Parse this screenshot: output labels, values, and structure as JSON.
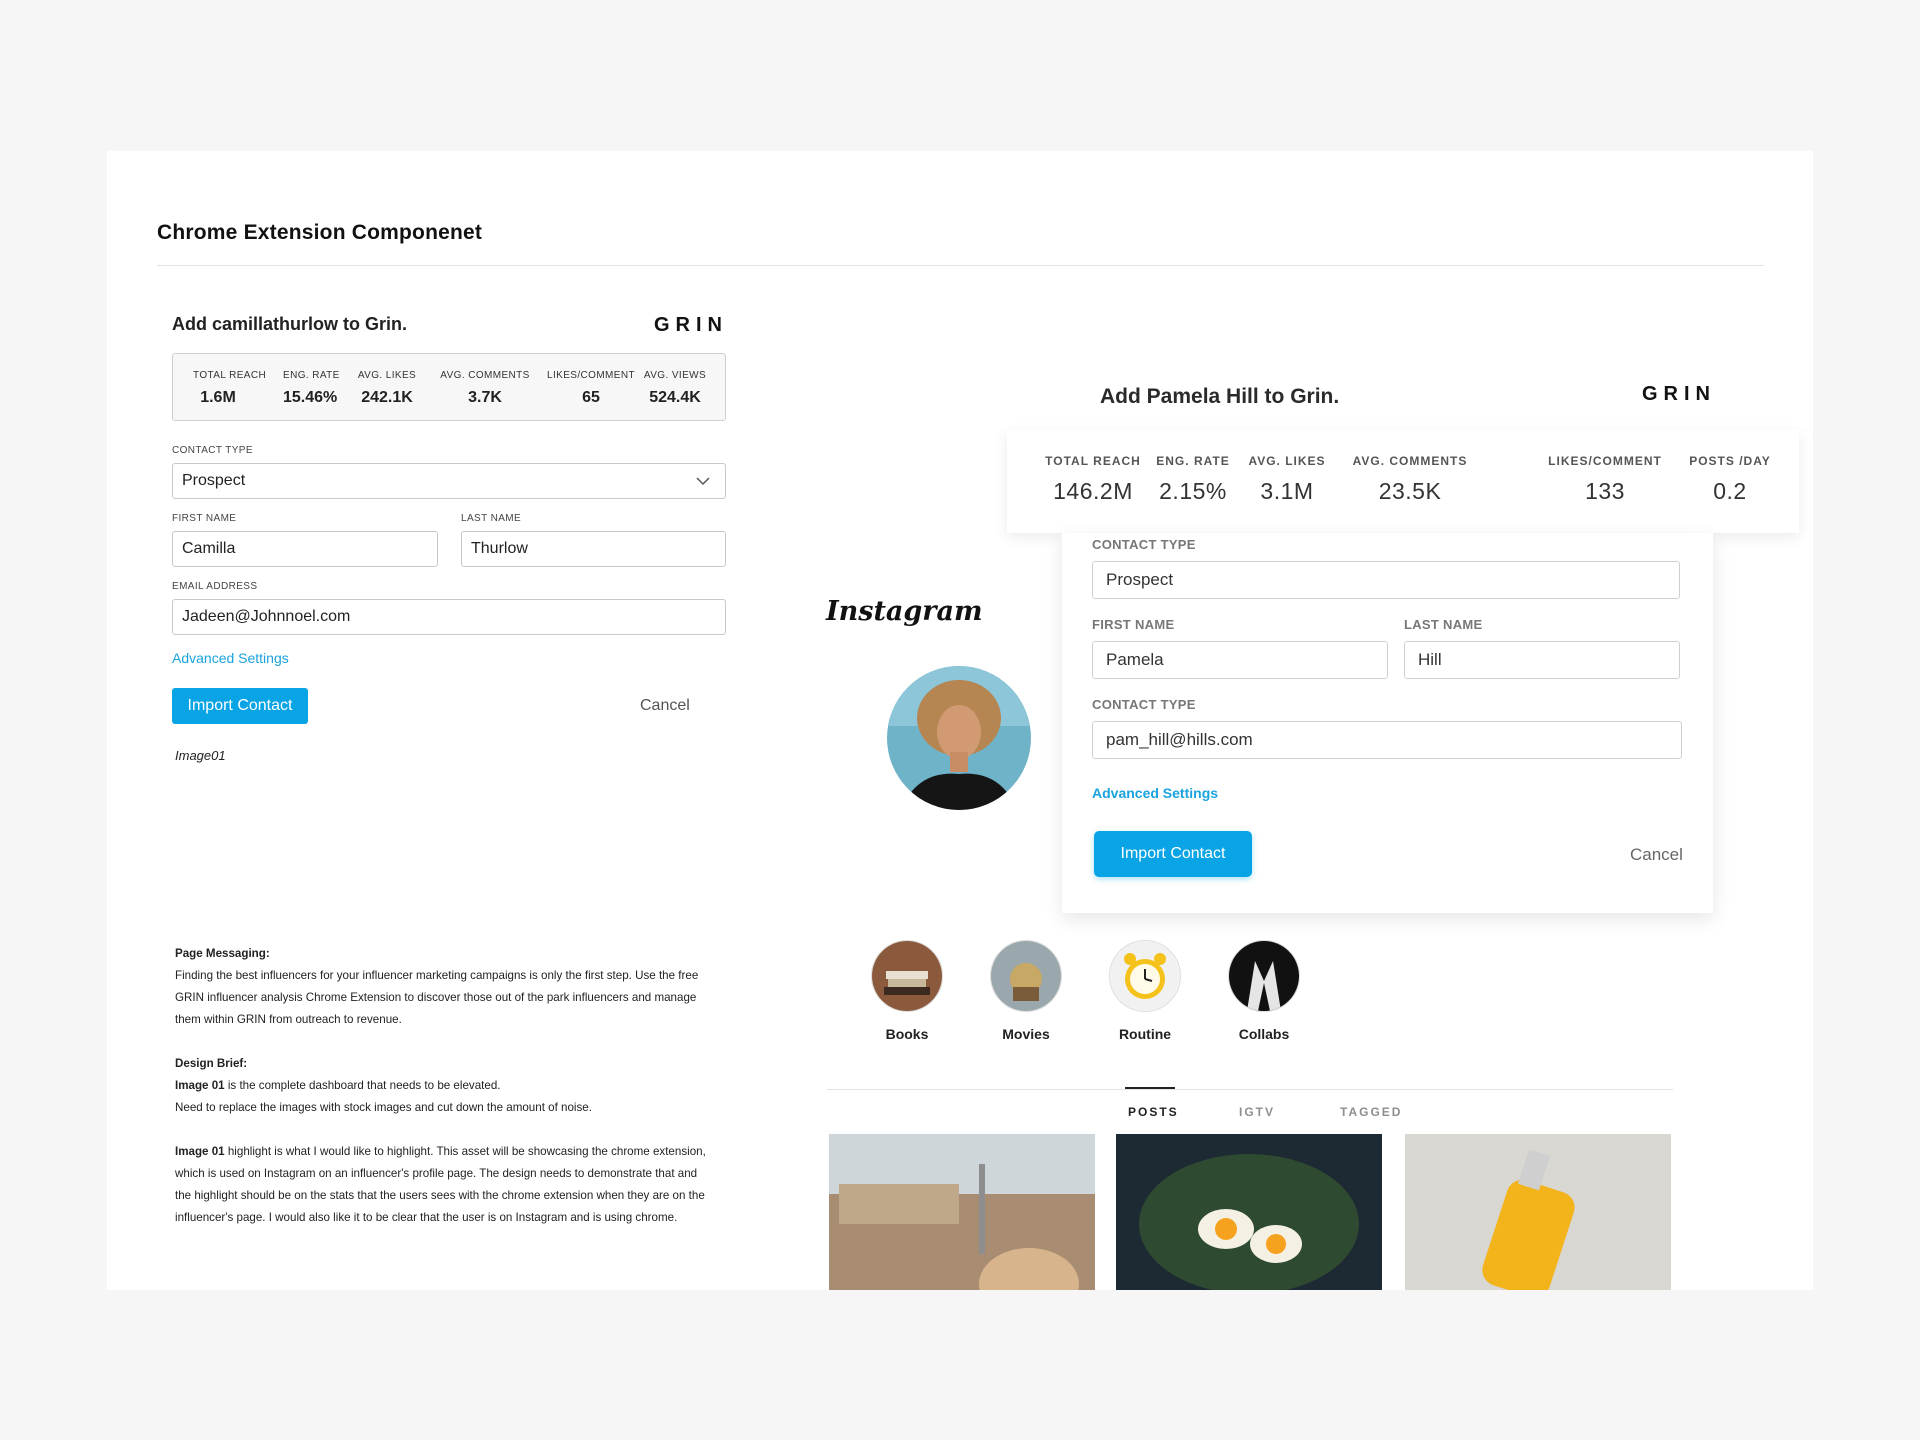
{
  "section_title": "Chrome Extension Componenet",
  "brand_logo": "GRIN",
  "panel1": {
    "title": "Add camillathurlow to Grin.",
    "stats": [
      {
        "label": "TOTAL REACH",
        "value": "1.6M"
      },
      {
        "label": "ENG. RATE",
        "value": "15.46%"
      },
      {
        "label": "AVG. LIKES",
        "value": "242.1K"
      },
      {
        "label": "AVG. COMMENTS",
        "value": "3.7K"
      },
      {
        "label": "LIKES/COMMENT",
        "value": "65"
      },
      {
        "label": "AVG. VIEWS",
        "value": "524.4K"
      }
    ],
    "contact_type_label": "CONTACT TYPE",
    "contact_type_value": "Prospect",
    "first_name_label": "FIRST NAME",
    "first_name_value": "Camilla",
    "last_name_label": "LAST NAME",
    "last_name_value": "Thurlow",
    "email_label": "EMAIL ADDRESS",
    "email_value": "Jadeen@Johnnoel.com",
    "advanced_settings": "Advanced Settings",
    "import_button": "Import Contact",
    "cancel_button": "Cancel",
    "caption": "Image01"
  },
  "notes": {
    "page_messaging_heading": "Page Messaging:",
    "page_messaging_lines": [
      "Finding the best influencers for your influencer marketing campaigns is only the first step. Use the free",
      "GRIN influencer analysis Chrome Extension to discover those out of the park influencers and manage",
      "them within GRIN from outreach to revenue."
    ],
    "design_brief_heading": "Design Brief:",
    "brief_line1_bold": "Image 01",
    "brief_line1_rest": " is the complete dashboard that needs to be elevated.",
    "brief_line2": "Need to replace the images with stock images and cut down the amount of noise.",
    "brief_p2_bold": "Image 01",
    "brief_p2_lines": [
      " highlight is what I would like to highlight. This asset will be showcasing the chrome extension,",
      "which is used on Instagram on an influencer's profile page. The design needs to demonstrate that and",
      "the highlight should be on the stats that the users sees with the chrome extension when they are on the",
      "influencer's page. I would also like it to be clear that the user is on Instagram and is using chrome."
    ]
  },
  "instagram": {
    "logo": "Instagram",
    "highlights": [
      {
        "label": "Books",
        "icon": "books-icon"
      },
      {
        "label": "Movies",
        "icon": "movies-icon"
      },
      {
        "label": "Routine",
        "icon": "alarm-clock-icon"
      },
      {
        "label": "Collabs",
        "icon": "collabs-icon"
      }
    ],
    "tabs": [
      "POSTS",
      "IGTV",
      "TAGGED"
    ],
    "active_tab": "POSTS"
  },
  "panel2": {
    "title": "Add Pamela Hill to Grin.",
    "stats": [
      {
        "label": "TOTAL REACH",
        "value": "146.2M"
      },
      {
        "label": "ENG. RATE",
        "value": "2.15%"
      },
      {
        "label": "AVG. LIKES",
        "value": "3.1M"
      },
      {
        "label": "AVG. COMMENTS",
        "value": "23.5K"
      },
      {
        "label": "LIKES/COMMENT",
        "value": "133"
      },
      {
        "label": "POSTS /DAY",
        "value": "0.2"
      }
    ],
    "contact_type_label": "CONTACT TYPE",
    "contact_type_value": "Prospect",
    "first_name_label": "FIRST NAME",
    "first_name_value": "Pamela",
    "last_name_label": "LAST NAME",
    "last_name_value": "Hill",
    "email_label": "CONTACT TYPE",
    "email_value": "pam_hill@hills.com",
    "advanced_settings": "Advanced Settings",
    "import_button": "Import Contact",
    "cancel_button": "Cancel"
  },
  "colors": {
    "accent": "#09a4e5",
    "link": "#1aa3df",
    "page_background": "#f6f6f6"
  }
}
